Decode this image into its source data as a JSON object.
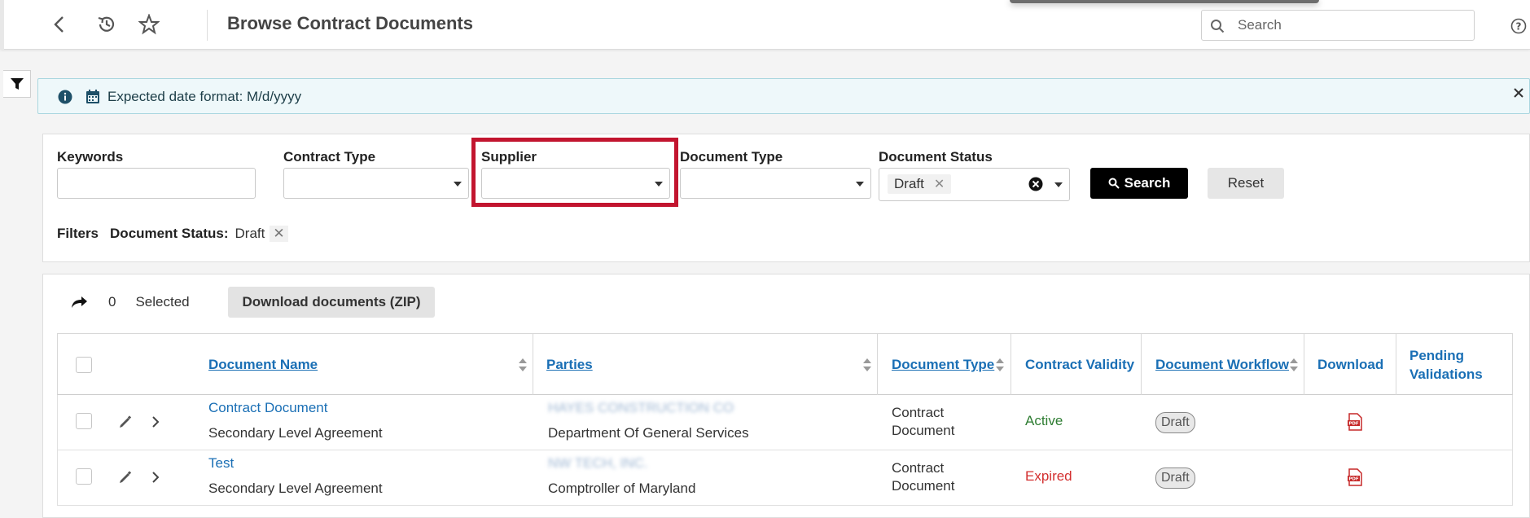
{
  "header": {
    "title": "Browse Contract Documents",
    "search_placeholder": "Search"
  },
  "info_banner": {
    "message": "Expected date format: M/d/yyyy"
  },
  "filters": {
    "keywords_label": "Keywords",
    "contract_type_label": "Contract Type",
    "supplier_label": "Supplier",
    "document_type_label": "Document Type",
    "document_status_label": "Document Status",
    "document_status_chip": "Draft",
    "search_button": "Search",
    "reset_button": "Reset",
    "applied_title": "Filters",
    "applied_key": "Document Status:",
    "applied_value": "Draft"
  },
  "selection": {
    "count": "0",
    "label": "Selected",
    "download_zip": "Download documents (ZIP)"
  },
  "table": {
    "columns": {
      "document_name": "Document Name",
      "parties": "Parties",
      "document_type": "Document Type",
      "contract_validity": "Contract Validity",
      "document_workflow": "Document Workflow",
      "download": "Download",
      "pending_validations_1": "Pending",
      "pending_validations_2": "Validations"
    },
    "rows": [
      {
        "name": "Contract Document",
        "subtitle": "Secondary Level Agreement",
        "party_blurred": "HAYES CONSTRUCTION CO",
        "party": "Department Of General Services",
        "doc_type_1": "Contract",
        "doc_type_2": "Document",
        "validity": "Active",
        "workflow": "Draft"
      },
      {
        "name": "Test",
        "subtitle": "Secondary Level Agreement",
        "party_blurred": "NW TECH, INC.",
        "party": "Comptroller of Maryland",
        "doc_type_1": "Contract",
        "doc_type_2": "Document",
        "validity": "Expired",
        "workflow": "Draft"
      }
    ]
  },
  "colors": {
    "link_blue": "#1a6fb5",
    "highlight_red": "#c2152f",
    "active_green": "#2e7d32",
    "expired_red": "#d32f2f"
  },
  "icons": [
    "back-icon",
    "history-icon",
    "star-icon",
    "search-icon",
    "help-icon",
    "filter-icon",
    "info-icon",
    "calendar-icon",
    "close-icon",
    "share-icon",
    "sort-icon",
    "edit-icon",
    "chevron-right-icon",
    "pdf-icon"
  ]
}
